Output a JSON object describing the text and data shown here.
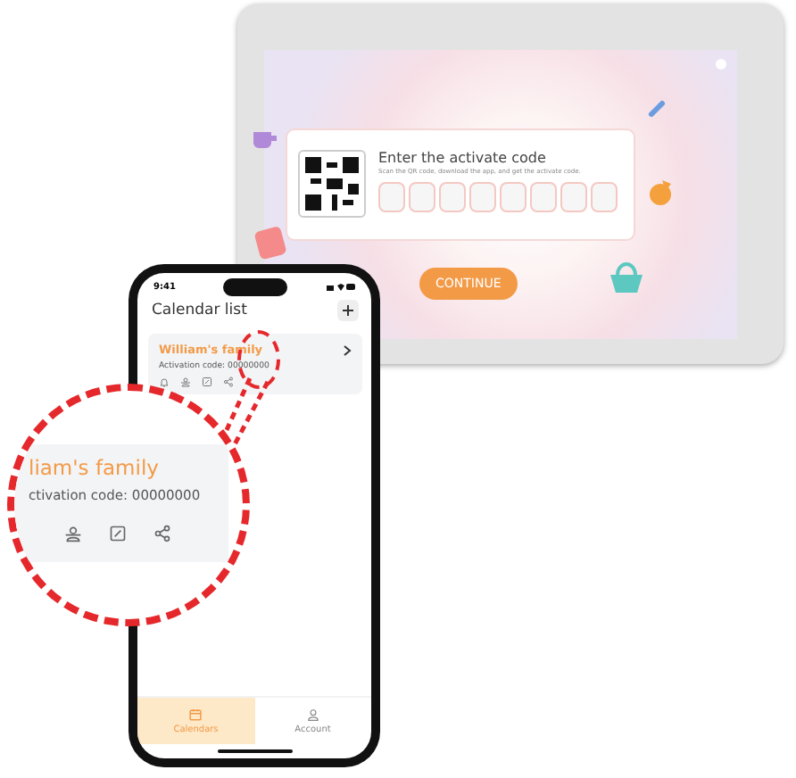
{
  "tablet": {
    "dialog": {
      "title": "Enter the activate code",
      "subtitle": "Scan the QR code, download the app, and get the activate code."
    },
    "button": "CONTINUE"
  },
  "phone": {
    "time": "9:41",
    "title": "Calendar list",
    "card": {
      "name": "William's family",
      "activation": "Activation code: 00000000"
    },
    "tabs": [
      {
        "label": "Calendars",
        "selected": true
      },
      {
        "label": "Account",
        "selected": false
      }
    ]
  },
  "magnifier": {
    "name": "liam's family",
    "activation": "ctivation code: 00000000"
  }
}
